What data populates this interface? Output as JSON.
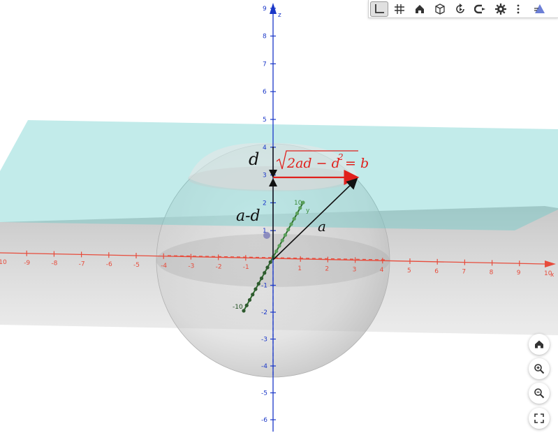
{
  "toolbar": {
    "items": [
      {
        "name": "axes-toggle-icon",
        "active": true
      },
      {
        "name": "grid-toggle-icon",
        "active": false
      },
      {
        "name": "home-icon",
        "active": false
      },
      {
        "name": "view-cube-icon",
        "active": false
      },
      {
        "name": "rotate-view-icon",
        "active": false
      },
      {
        "name": "projection-icon",
        "active": false
      },
      {
        "name": "settings-gear-icon",
        "active": false
      },
      {
        "name": "more-vertical-icon",
        "active": false
      },
      {
        "name": "perspective-icon",
        "active": false
      }
    ]
  },
  "nav_buttons": [
    {
      "name": "home-icon"
    },
    {
      "name": "zoom-in-icon"
    },
    {
      "name": "zoom-out-icon"
    },
    {
      "name": "fullscreen-icon"
    }
  ],
  "axes": {
    "x_label": "x",
    "y_label": "y",
    "z_label": "z",
    "x_ticks": [
      "-10",
      "-9",
      "-8",
      "-7",
      "-6",
      "-5",
      "-4",
      "-3",
      "-2",
      "-1",
      "0",
      "1",
      "2",
      "3",
      "4",
      "5",
      "6",
      "7",
      "8",
      "9",
      "10"
    ],
    "z_ticks_up": [
      "1",
      "2",
      "3",
      "4",
      "5",
      "6",
      "7",
      "8",
      "9"
    ],
    "z_ticks_down": [
      "-1",
      "-2",
      "-3",
      "-4",
      "-5",
      "-6"
    ],
    "y_ticks": [
      "-10",
      "10"
    ],
    "colors": {
      "x": "#e74c3c",
      "z": "#1a37c8",
      "y": "#3c8c3c"
    }
  },
  "annotations": {
    "d": "d",
    "a_minus_d": "a-d",
    "a": "a",
    "formula_rad": "2ad − d",
    "formula_exp": "2",
    "formula_rhs": " = b"
  },
  "colors": {
    "plane_top": "#5ecac8",
    "plane_bottom": "#9a9a9a",
    "sphere": "#d8d8d8",
    "arrow_b": "#e0201c",
    "arrow_a": "#111111"
  }
}
